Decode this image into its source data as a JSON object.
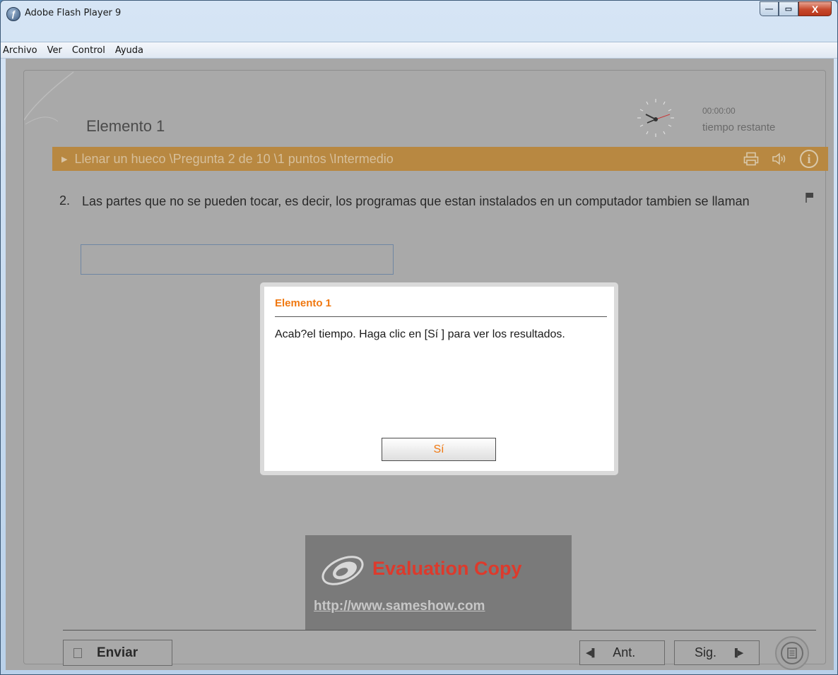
{
  "window": {
    "title": "Adobe Flash Player 9",
    "app_icon": "flash-player-icon",
    "controls": {
      "minimize": "—",
      "maximize": "▭",
      "close": "X"
    }
  },
  "menu": [
    "Archivo",
    "Ver",
    "Control",
    "Ayuda"
  ],
  "quiz": {
    "element_title": "Elemento 1",
    "timer": {
      "value": "00:00:00",
      "label": "tiempo restante"
    },
    "question_bar": {
      "text": "Llenar un hueco \\Pregunta 2 de  10 \\1 puntos \\Intermedio",
      "icons": [
        "print-icon",
        "sound-icon",
        "info-icon"
      ],
      "color": "#b88841"
    },
    "question": {
      "number": "2.",
      "text": "Las partes que no se pueden tocar, es decir, los  programas que estan instalados en un computador tambien se llaman"
    },
    "answer": {
      "value": "",
      "placeholder": ""
    }
  },
  "dialog": {
    "title": "Elemento 1",
    "message": "Acab?el tiempo. Haga clic en [Sí ] para ver los resultados.",
    "button": "Sí",
    "accent": "#f07810"
  },
  "watermark": {
    "title": "Evaluation Copy",
    "url": "http://www.sameshow.com"
  },
  "footer": {
    "submit": "Enviar",
    "prev": "Ant.",
    "next": "Sig."
  }
}
